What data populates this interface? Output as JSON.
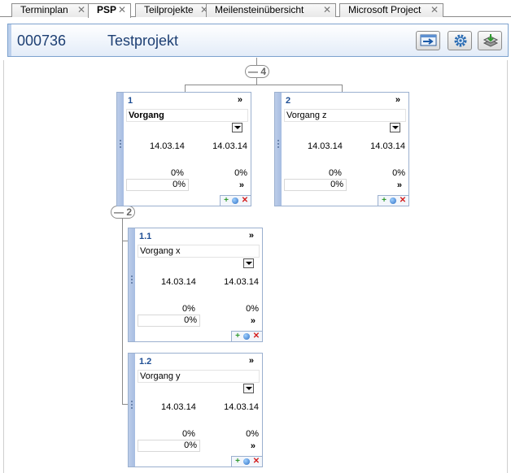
{
  "tabs": [
    {
      "label": "Terminplan",
      "active": false
    },
    {
      "label": "PSP",
      "active": true
    },
    {
      "label": "Teilprojekte",
      "active": false
    },
    {
      "label": "Meilensteinübersicht",
      "active": false
    },
    {
      "label": "Microsoft Project",
      "active": false
    }
  ],
  "tab_close_glyph": "✕",
  "header": {
    "project_number": "000736",
    "project_name": "Testprojekt",
    "buttons": [
      {
        "icon": "export-icon"
      },
      {
        "icon": "gear-icon"
      },
      {
        "icon": "layers-download-icon"
      }
    ]
  },
  "collapse_root": "— 4",
  "collapse_node1": "— 2",
  "nodes": [
    {
      "id": "1",
      "name": "Vorgang",
      "bold": true,
      "start": "14.03.14",
      "end": "14.03.14",
      "progress_a": "0%",
      "progress_b": "0%",
      "progress_input": "0%"
    },
    {
      "id": "2",
      "name": "Vorgang z",
      "bold": false,
      "start": "14.03.14",
      "end": "14.03.14",
      "progress_a": "0%",
      "progress_b": "0%",
      "progress_input": "0%"
    },
    {
      "id": "1.1",
      "name": "Vorgang x",
      "bold": false,
      "start": "14.03.14",
      "end": "14.03.14",
      "progress_a": "0%",
      "progress_b": "0%",
      "progress_input": "0%"
    },
    {
      "id": "1.2",
      "name": "Vorgang y",
      "bold": false,
      "start": "14.03.14",
      "end": "14.03.14",
      "progress_a": "0%",
      "progress_b": "0%",
      "progress_input": "0%"
    }
  ],
  "more_glyph": "»",
  "action_glyphs": {
    "add": "+",
    "delete": "✕"
  },
  "colors": {
    "accent": "#1e4e94",
    "title": "#1d3f73",
    "card_border": "#9bb0cf",
    "add": "#2f9a2f",
    "delete": "#d41f1f"
  }
}
